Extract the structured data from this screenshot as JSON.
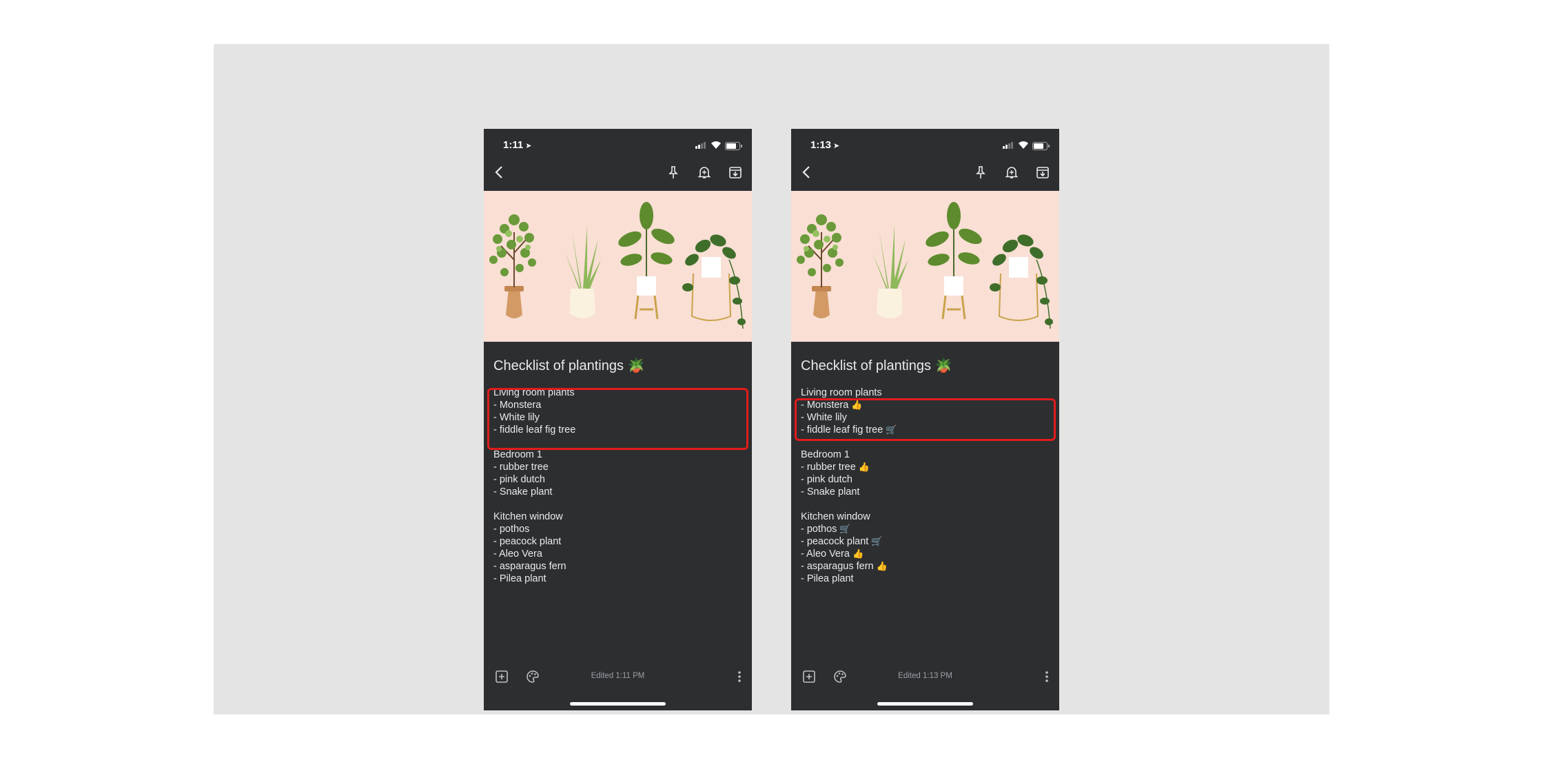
{
  "colors": {
    "background": "#ffffff",
    "panel": "#e4e4e4",
    "note_bg": "#2d2e30",
    "hero_bg": "#f9dfd4",
    "highlight": "#e11c1c"
  },
  "icons": [
    "location-arrow-icon",
    "signal-icon",
    "wifi-icon",
    "battery-icon",
    "back-arrow-icon",
    "pin-icon",
    "reminder-bell-icon",
    "archive-icon",
    "plant-illustration",
    "add-box-icon",
    "palette-icon",
    "more-vert-icon"
  ],
  "screens": [
    {
      "status": {
        "time": "1:11"
      },
      "title": "Checklist of plantings",
      "title_emoji": "🪴",
      "sections": [
        {
          "heading": "Living room plants",
          "items": [
            {
              "text": "- Monstera",
              "mark": ""
            },
            {
              "text": "- White lily",
              "mark": ""
            },
            {
              "text": "- fiddle leaf fig tree",
              "mark": ""
            }
          ]
        },
        {
          "heading": "Bedroom 1",
          "items": [
            {
              "text": "- rubber tree",
              "mark": ""
            },
            {
              "text": "- pink dutch",
              "mark": ""
            },
            {
              "text": "- Snake plant",
              "mark": ""
            }
          ]
        },
        {
          "heading": "Kitchen window",
          "items": [
            {
              "text": "- pothos",
              "mark": ""
            },
            {
              "text": "- peacock plant",
              "mark": ""
            },
            {
              "text": "- Aleo Vera",
              "mark": ""
            },
            {
              "text": "- asparagus fern",
              "mark": ""
            },
            {
              "text": "- Pilea plant",
              "mark": ""
            }
          ]
        }
      ],
      "edited": "Edited 1:11 PM"
    },
    {
      "status": {
        "time": "1:13"
      },
      "title": "Checklist of plantings",
      "title_emoji": "🪴",
      "sections": [
        {
          "heading": "Living room plants",
          "items": [
            {
              "text": "- Monstera",
              "mark": "👍"
            },
            {
              "text": "- White lily",
              "mark": ""
            },
            {
              "text": "- fiddle leaf fig tree",
              "mark": "🛒"
            }
          ]
        },
        {
          "heading": "Bedroom 1",
          "items": [
            {
              "text": "- rubber tree",
              "mark": "👍"
            },
            {
              "text": "- pink dutch",
              "mark": ""
            },
            {
              "text": "- Snake plant",
              "mark": ""
            }
          ]
        },
        {
          "heading": "Kitchen window",
          "items": [
            {
              "text": "- pothos",
              "mark": "🛒"
            },
            {
              "text": "- peacock plant",
              "mark": "🛒"
            },
            {
              "text": "- Aleo Vera",
              "mark": "👍"
            },
            {
              "text": "- asparagus fern",
              "mark": "👍"
            },
            {
              "text": "- Pilea plant",
              "mark": ""
            }
          ]
        }
      ],
      "edited": "Edited 1:13 PM"
    }
  ]
}
